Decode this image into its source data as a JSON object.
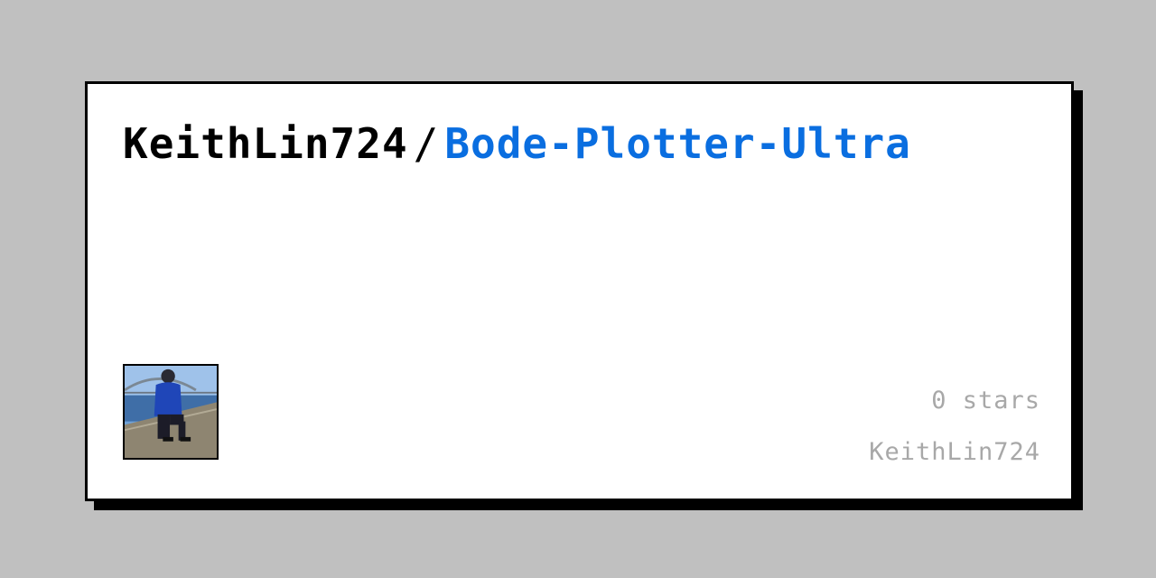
{
  "card": {
    "owner": "KeithLin724",
    "separator": "/",
    "repo": "Bode-Plotter-Ultra",
    "stars_label": "0 stars",
    "footer_user": "KeithLin724"
  },
  "avatar": {
    "icon": "user-avatar-photo"
  },
  "colors": {
    "background": "#c0c0c0",
    "card": "#ffffff",
    "border": "#000000",
    "repo": "#0a6ee0",
    "muted": "#a8a8a8"
  }
}
